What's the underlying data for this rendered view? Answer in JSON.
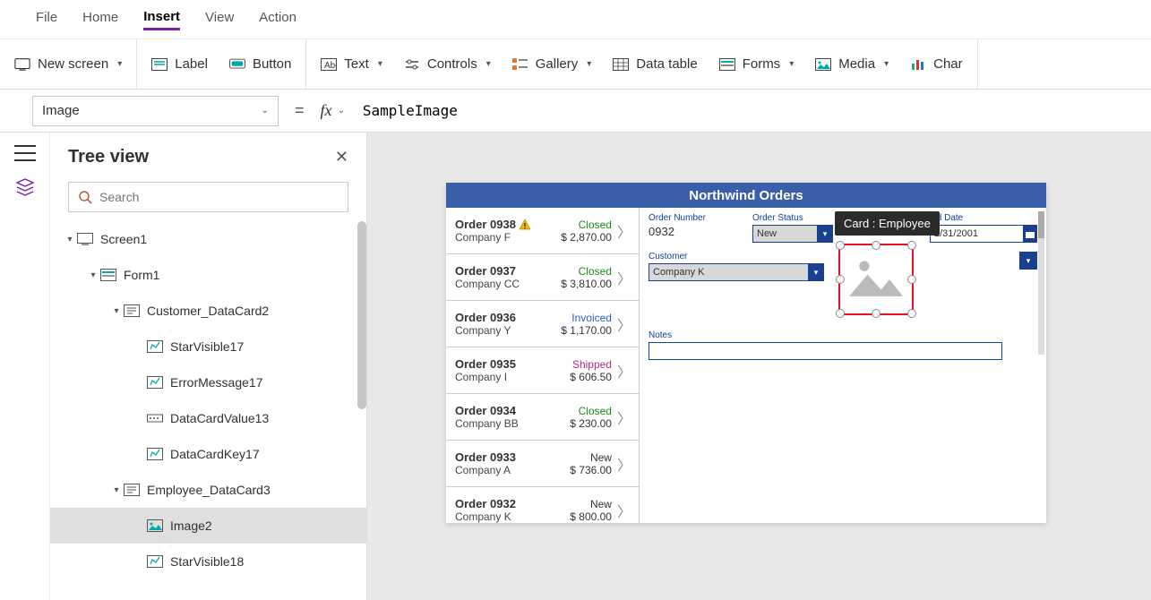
{
  "menu": {
    "items": [
      "File",
      "Home",
      "Insert",
      "View",
      "Action"
    ],
    "active_index": 2
  },
  "ribbon": {
    "new_screen": "New screen",
    "label": "Label",
    "button": "Button",
    "text": "Text",
    "controls": "Controls",
    "gallery": "Gallery",
    "data_table": "Data table",
    "forms": "Forms",
    "media": "Media",
    "charts": "Char"
  },
  "formula": {
    "property": "Image",
    "value": "SampleImage"
  },
  "tree": {
    "title": "Tree view",
    "search_placeholder": "Search",
    "nodes": {
      "screen": "Screen1",
      "form": "Form1",
      "customer_card": "Customer_DataCard2",
      "starvisible17": "StarVisible17",
      "errormessage17": "ErrorMessage17",
      "datacardvalue13": "DataCardValue13",
      "datacardkey17": "DataCardKey17",
      "employee_card": "Employee_DataCard3",
      "image2": "Image2",
      "starvisible18": "StarVisible18"
    }
  },
  "app": {
    "title": "Northwind Orders",
    "orders": [
      {
        "num": "Order 0938",
        "warn": true,
        "company": "Company F",
        "status": "Closed",
        "st_cls": "st-closed",
        "amount": "$ 2,870.00"
      },
      {
        "num": "Order 0937",
        "warn": false,
        "company": "Company CC",
        "status": "Closed",
        "st_cls": "st-closed",
        "amount": "$ 3,810.00"
      },
      {
        "num": "Order 0936",
        "warn": false,
        "company": "Company Y",
        "status": "Invoiced",
        "st_cls": "st-invoiced",
        "amount": "$ 1,170.00"
      },
      {
        "num": "Order 0935",
        "warn": false,
        "company": "Company I",
        "status": "Shipped",
        "st_cls": "st-shipped",
        "amount": "$ 606.50"
      },
      {
        "num": "Order 0934",
        "warn": false,
        "company": "Company BB",
        "status": "Closed",
        "st_cls": "st-closed",
        "amount": "$ 230.00"
      },
      {
        "num": "Order 0933",
        "warn": false,
        "company": "Company A",
        "status": "New",
        "st_cls": "st-new",
        "amount": "$ 736.00"
      },
      {
        "num": "Order 0932",
        "warn": false,
        "company": "Company K",
        "status": "New",
        "st_cls": "st-new",
        "amount": "$ 800.00"
      }
    ],
    "detail": {
      "order_number_label": "Order Number",
      "order_number": "0932",
      "order_status_label": "Order Status",
      "order_status": "New",
      "paid_date_label": "aid Date",
      "paid_date": "2/31/2001",
      "customer_label": "Customer",
      "customer": "Company K",
      "notes_label": "Notes",
      "tooltip": "Card : Employee"
    }
  }
}
